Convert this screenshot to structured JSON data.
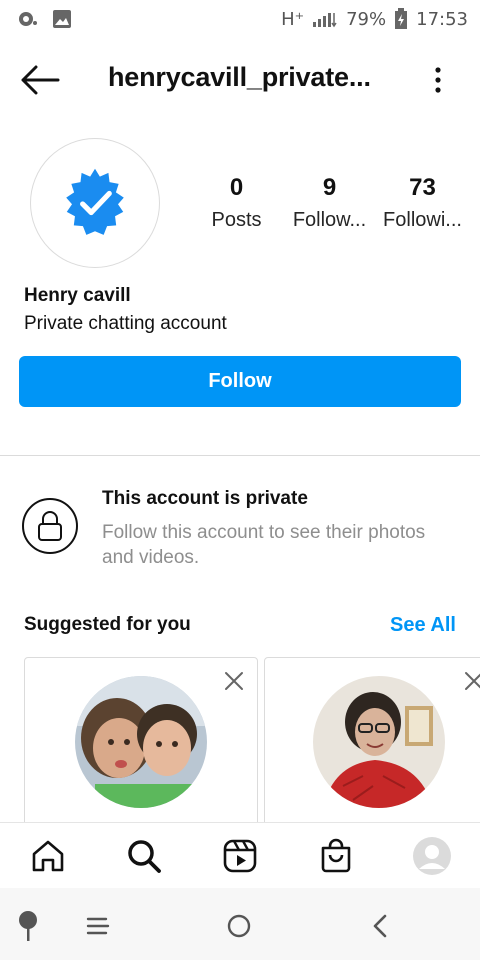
{
  "status_bar": {
    "network": "H⁺",
    "battery": "79%",
    "time": "17:53"
  },
  "header": {
    "username": "henrycavill_private...",
    "back_icon": "arrow-left-icon",
    "more_icon": "more-vertical-icon"
  },
  "profile": {
    "avatar_icon": "verified-badge-icon",
    "badge_color": "#1a8cf0",
    "stats": [
      {
        "value": "0",
        "label": "Posts"
      },
      {
        "value": "9",
        "label": "Follow..."
      },
      {
        "value": "73",
        "label": "Followi..."
      }
    ],
    "name": "Henry cavill",
    "bio": "Private chatting account"
  },
  "follow_button": {
    "label": "Follow",
    "color": "#0095f6"
  },
  "private_notice": {
    "icon": "lock-icon",
    "title": "This account is private",
    "text": "Follow this account to see their photos and videos."
  },
  "suggested": {
    "heading": "Suggested for you",
    "see_all": "See All",
    "cards": [
      {
        "photo": "profile-photo-two-children",
        "close_icon": "close-icon"
      },
      {
        "photo": "profile-photo-woman-red-jacket",
        "close_icon": "close-icon"
      }
    ]
  },
  "bottom_nav": [
    {
      "icon": "home-icon"
    },
    {
      "icon": "search-icon"
    },
    {
      "icon": "reels-icon"
    },
    {
      "icon": "shop-icon"
    },
    {
      "icon": "profile-avatar-icon"
    }
  ],
  "system_nav": [
    {
      "icon": "assistant-icon"
    },
    {
      "icon": "menu-icon"
    },
    {
      "icon": "home-circle-icon"
    },
    {
      "icon": "back-chevron-icon"
    }
  ]
}
